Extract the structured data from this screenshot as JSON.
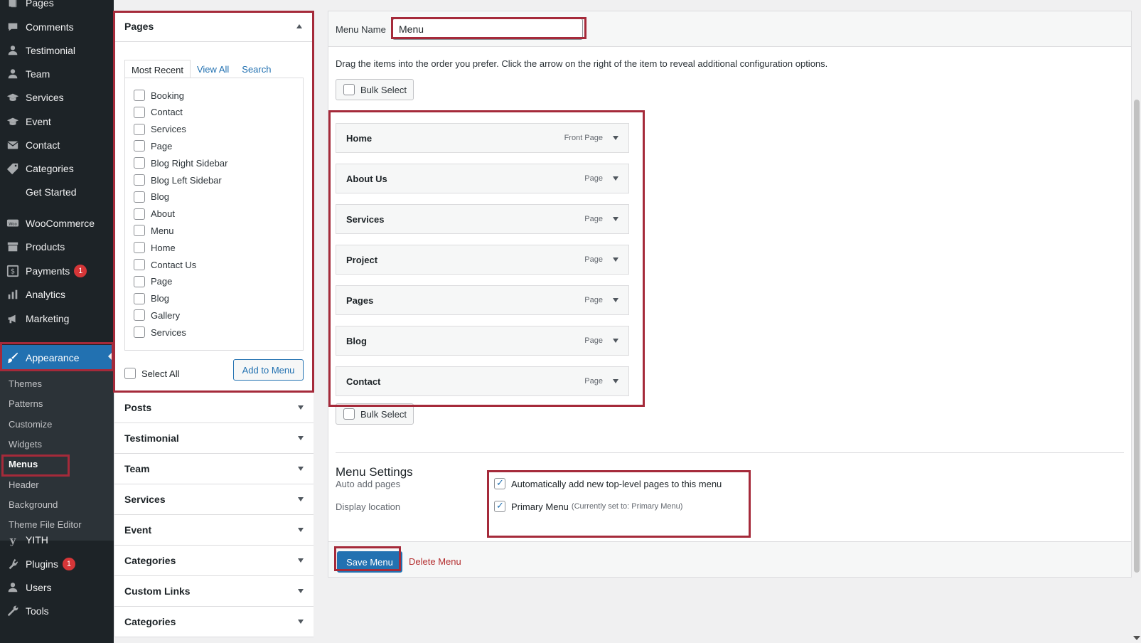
{
  "sidebar": {
    "items": [
      {
        "label": "Pages",
        "icon": "pages-icon"
      },
      {
        "label": "Comments",
        "icon": "comments-icon"
      },
      {
        "label": "Testimonial",
        "icon": "user-icon"
      },
      {
        "label": "Team",
        "icon": "user-icon"
      },
      {
        "label": "Services",
        "icon": "graduation-cap-icon"
      },
      {
        "label": "Event",
        "icon": "graduation-cap-icon"
      },
      {
        "label": "Contact",
        "icon": "email-icon"
      },
      {
        "label": "Categories",
        "icon": "tag-icon"
      },
      {
        "label": "Get Started",
        "icon": ""
      },
      {
        "label": "WooCommerce",
        "icon": "woocommerce-icon"
      },
      {
        "label": "Products",
        "icon": "archive-icon"
      },
      {
        "label": "Payments",
        "icon": "dollar-icon",
        "badge": "1"
      },
      {
        "label": "Analytics",
        "icon": "bar-chart-icon"
      },
      {
        "label": "Marketing",
        "icon": "megaphone-icon"
      },
      {
        "label": "Appearance",
        "icon": "paintbrush-icon",
        "active": true
      },
      {
        "label": "YITH",
        "icon": "yith-icon"
      },
      {
        "label": "Plugins",
        "icon": "plugin-icon",
        "badge": "1"
      },
      {
        "label": "Users",
        "icon": "user-icon"
      },
      {
        "label": "Tools",
        "icon": "wrench-icon"
      }
    ],
    "submenu": [
      "Themes",
      "Patterns",
      "Customize",
      "Widgets",
      "Menus",
      "Header",
      "Background",
      "Theme File Editor"
    ],
    "current_submenu": "Menus"
  },
  "pages_panel": {
    "title": "Pages",
    "tabs": [
      "Most Recent",
      "View All",
      "Search"
    ],
    "items": [
      "Booking",
      "Contact",
      "Services",
      "Page",
      "Blog Right Sidebar",
      "Blog Left Sidebar",
      "Blog",
      "About",
      "Menu",
      "Home",
      "Contact Us",
      "Page",
      "Blog",
      "Gallery",
      "Services"
    ],
    "select_all": "Select All",
    "add_button": "Add to Menu"
  },
  "accordion": [
    "Posts",
    "Testimonial",
    "Team",
    "Services",
    "Event",
    "Categories",
    "Custom Links",
    "Categories"
  ],
  "editor": {
    "menu_name_label": "Menu Name",
    "menu_name_value": "Menu",
    "instructions": "Drag the items into the order you prefer. Click the arrow on the right of the item to reveal additional configuration options.",
    "bulk_select": "Bulk Select",
    "menu_items": [
      {
        "title": "Home",
        "type": "Front Page"
      },
      {
        "title": "About Us",
        "type": "Page"
      },
      {
        "title": "Services",
        "type": "Page"
      },
      {
        "title": "Project",
        "type": "Page"
      },
      {
        "title": "Pages",
        "type": "Page"
      },
      {
        "title": "Blog",
        "type": "Page"
      },
      {
        "title": "Contact",
        "type": "Page"
      }
    ],
    "settings_title": "Menu Settings",
    "auto_add_label": "Auto add pages",
    "auto_add_option": "Automatically add new top-level pages to this menu",
    "display_location_label": "Display location",
    "primary_menu_option": "Primary Menu",
    "primary_menu_note": "(Currently set to: Primary Menu)",
    "save_button": "Save Menu",
    "delete_link": "Delete Menu"
  },
  "colors": {
    "accent": "#2271b1",
    "highlight": "#a52a3a",
    "sidebar_bg": "#1d2327",
    "danger": "#d63638"
  }
}
